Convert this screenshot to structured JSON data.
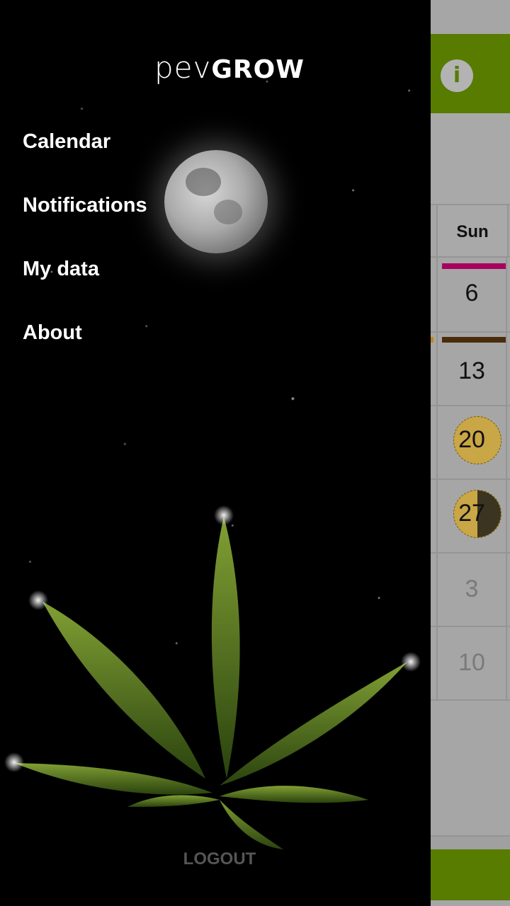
{
  "drawer": {
    "logo": {
      "part1": "pev",
      "part2": "GROW"
    },
    "menu": [
      {
        "label": "Calendar"
      },
      {
        "label": "Notifications"
      },
      {
        "label": "My data"
      },
      {
        "label": "About"
      }
    ],
    "logout_label": "LOGOUT"
  },
  "calendar": {
    "info_icon": "info-icon",
    "info_glyph": "i",
    "day_header": "Sun",
    "cells": [
      {
        "day": "6",
        "marker_color": "#a8005e",
        "moon": ""
      },
      {
        "day": "13",
        "marker_color": "#4a2c0c",
        "moon": ""
      },
      {
        "day": "20",
        "moon": "full"
      },
      {
        "day": "27",
        "moon": "half"
      },
      {
        "day": "3",
        "faded": true
      },
      {
        "day": "10",
        "faded": true
      }
    ]
  },
  "colors": {
    "brand_green": "#577c00",
    "background_dim": "#a6a6a6"
  }
}
